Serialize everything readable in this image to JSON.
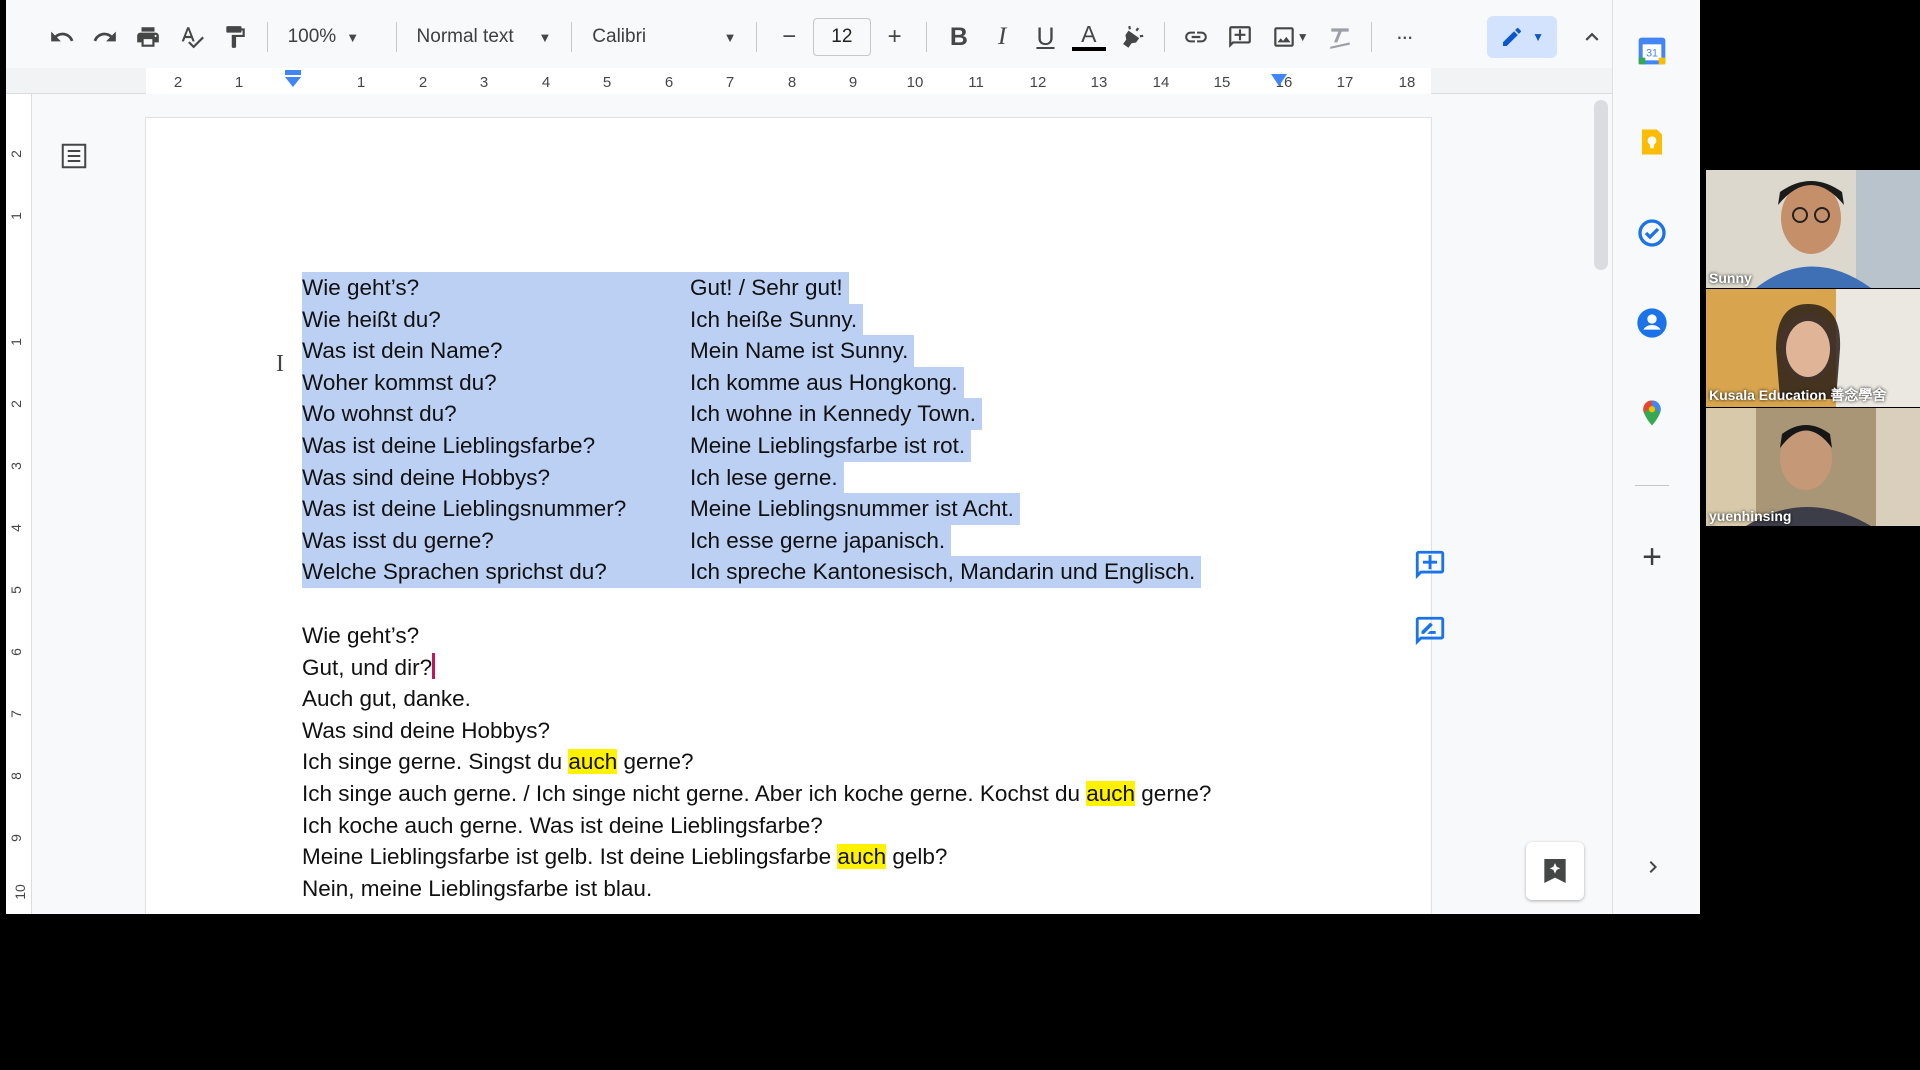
{
  "toolbar": {
    "zoom": "100%",
    "style": "Normal text",
    "font": "Calibri",
    "font_size": "12",
    "minus": "−",
    "plus": "+",
    "bold": "B",
    "italic": "I",
    "underline": "U",
    "text_color": "A",
    "more": "···"
  },
  "ruler": {
    "ticks": [
      "2",
      "1",
      "1",
      "2",
      "3",
      "4",
      "5",
      "6",
      "7",
      "8",
      "9",
      "10",
      "11",
      "12",
      "13",
      "14",
      "15",
      "16",
      "17",
      "18"
    ]
  },
  "vertical_ruler": {
    "ticks": [
      "2",
      "1",
      "1",
      "2",
      "3",
      "4",
      "5",
      "6",
      "7",
      "8",
      "9",
      "10"
    ]
  },
  "document": {
    "qa_rows": [
      {
        "q": "Wie geht’s?",
        "a": "Gut! / Sehr gut!"
      },
      {
        "q": "Wie heißt du?",
        "a": "Ich heiße Sunny."
      },
      {
        "q": "Was ist dein Name?",
        "a": "Mein Name ist Sunny."
      },
      {
        "q": "Woher kommst du?",
        "a": "Ich komme aus Hongkong."
      },
      {
        "q": "Wo wohnst du?",
        "a": "Ich wohne in Kennedy Town."
      },
      {
        "q": "Was ist deine Lieblingsfarbe?",
        "a": "Meine Lieblingsfarbe ist rot."
      },
      {
        "q": "Was sind deine Hobbys?",
        "a": "Ich lese gerne."
      },
      {
        "q": "Was ist deine Lieblingsnummer?",
        "a": "Meine Lieblingsnummer ist Acht."
      },
      {
        "q": "Was isst du gerne?",
        "a": "Ich esse gerne japanisch."
      },
      {
        "q": "Welche Sprachen sprichst du?",
        "a": "Ich spreche Kantonesisch, Mandarin und Englisch."
      }
    ],
    "dialog": {
      "l1": "Wie geht’s?",
      "l2": "Gut, und dir?",
      "l3": "Auch gut, danke.",
      "l4": "Was sind deine Hobbys?",
      "l5a": "Ich singe gerne. Singst du ",
      "l5b": "auch",
      "l5c": " gerne?",
      "l6a": "Ich singe auch gerne. / Ich singe nicht gerne. Aber ich koche gerne. Kochst du ",
      "l6b": "auch",
      "l6c": " gerne?",
      "l7": "Ich koche auch gerne. Was ist deine Lieblingsfarbe?",
      "l8a": "Meine Lieblingsfarbe ist gelb. Ist deine Lieblingsfarbe ",
      "l8b": "auch",
      "l8c": " gelb?",
      "l9": "Nein, meine Lieblingsfarbe ist blau."
    }
  },
  "video_call": {
    "participants": [
      "Sunny",
      "Kusala Education 善念學舍",
      "yuenhinsing"
    ]
  },
  "colors": {
    "selection": "#bcd0f4",
    "highlight": "#fff200",
    "accent": "#1a73e8"
  }
}
